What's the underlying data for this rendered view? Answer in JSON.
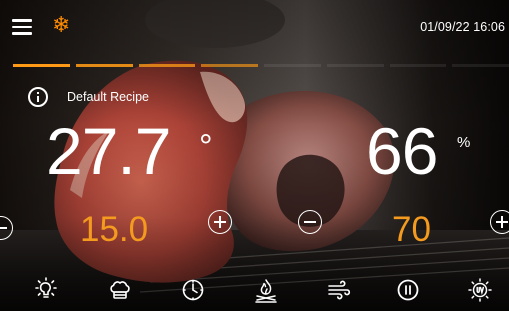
{
  "status_bar": {
    "menu_icon": "hamburger-menu-icon",
    "mode_icon": "snowflake-icon",
    "mode_icon_color": "#ff8c00",
    "datetime": "01/09/22 16:06"
  },
  "progress": {
    "segments": 8,
    "active_segments": 4,
    "active_color": "#ff9a16"
  },
  "recipe": {
    "info_icon": "info-icon",
    "name": "Default Recipe"
  },
  "temperature": {
    "current": "27.7",
    "unit": "°",
    "setpoint": "15.0",
    "setpoint_color": "#f39a1f"
  },
  "humidity": {
    "current": "66",
    "unit": "%",
    "setpoint": "70"
  },
  "toolbar": {
    "items": [
      {
        "icon": "light-bulb-icon"
      },
      {
        "icon": "chef-hat-icon"
      },
      {
        "icon": "clock-icon"
      },
      {
        "icon": "smoke-fire-icon"
      },
      {
        "icon": "wind-fan-icon"
      },
      {
        "icon": "pause-icon"
      },
      {
        "icon": "uv-lamp-icon"
      }
    ]
  }
}
